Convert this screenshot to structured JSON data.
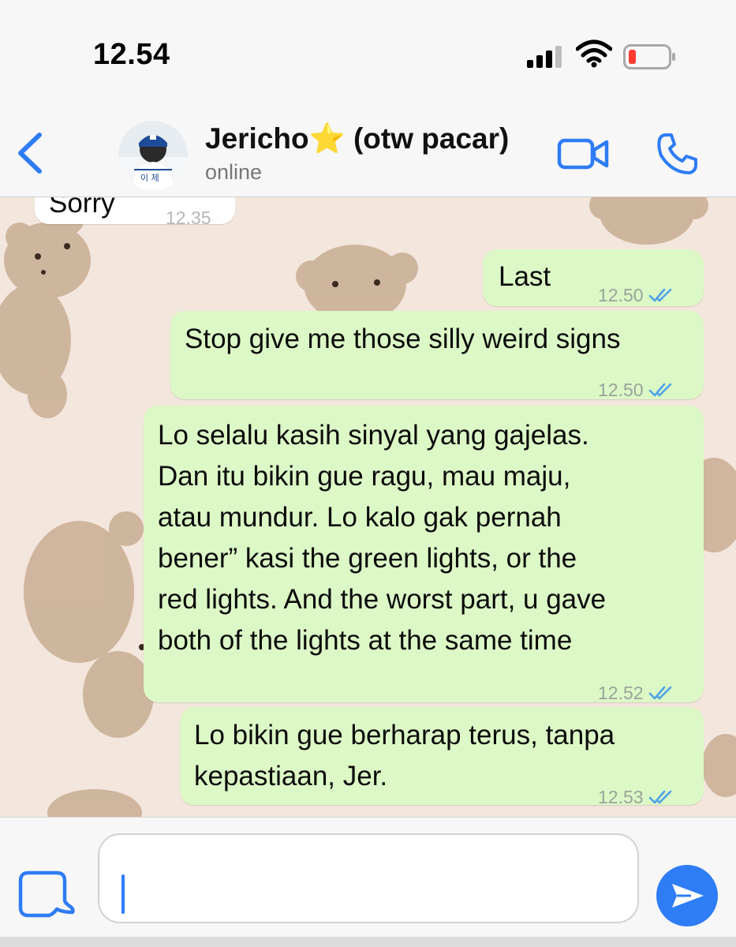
{
  "status_bar": {
    "time": "12.54",
    "icons": [
      "cellular-signal-icon",
      "wifi-icon",
      "battery-low-icon"
    ]
  },
  "header": {
    "contact_name": "Jericho⭐️ (otw pacar)",
    "status": "online",
    "icons": [
      "back-chevron-icon",
      "video-call-icon",
      "phone-icon"
    ]
  },
  "messages": [
    {
      "direction": "in",
      "text": "Sorry",
      "time": "12.35"
    },
    {
      "direction": "out",
      "text": "Last",
      "time": "12.50",
      "read": true
    },
    {
      "direction": "out",
      "text": "Stop give me those silly weird signs",
      "time": "12.50",
      "read": true
    },
    {
      "direction": "out",
      "lines": [
        "Lo selalu kasih sinyal yang gajelas.",
        "Dan itu bikin gue ragu, mau maju,",
        "atau mundur. Lo kalo gak pernah",
        "bener” kasi the green lights, or the",
        "red lights. And the worst part, u gave",
        "both of the lights at the same time"
      ],
      "time": "12.52",
      "read": true
    },
    {
      "direction": "out",
      "lines": [
        "Lo bikin gue berharap terus, tanpa",
        "kepastiaan, Jer."
      ],
      "time": "12.53",
      "read": true
    }
  ],
  "input": {
    "value": "",
    "icons": [
      "sticker-icon",
      "send-icon"
    ]
  },
  "colors": {
    "accent": "#2e7cf6",
    "outgoing_bubble": "#dcf8c6",
    "incoming_bubble": "#ffffff",
    "read_ticks": "#4fa3e8",
    "wallpaper": "#f3e6dc"
  }
}
